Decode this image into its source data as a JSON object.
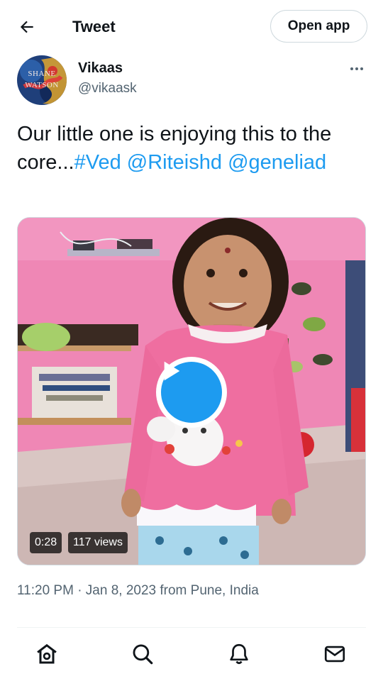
{
  "header": {
    "title": "Tweet",
    "open_app_label": "Open app"
  },
  "author": {
    "avatar_text_line1": "SHANE",
    "avatar_text_line2": "WATSON",
    "display_name": "Vikaas",
    "handle": "@vikaask"
  },
  "tweet": {
    "text_plain": "Our little one is enjoying this to the core...",
    "hashtag": "#Ved",
    "mention_1": "@Riteishd",
    "mention_2": "@geneliad"
  },
  "media": {
    "duration": "0:28",
    "views": "117 views"
  },
  "meta": {
    "timestamp": "11:20 PM · Jan 8, 2023 from Pune, India"
  },
  "nav": [
    "home-icon",
    "search-icon",
    "notifications-icon",
    "messages-icon"
  ],
  "colors": {
    "link": "#1d9bf0",
    "secondary_text": "#536471",
    "play_button": "#1d9bf0"
  }
}
